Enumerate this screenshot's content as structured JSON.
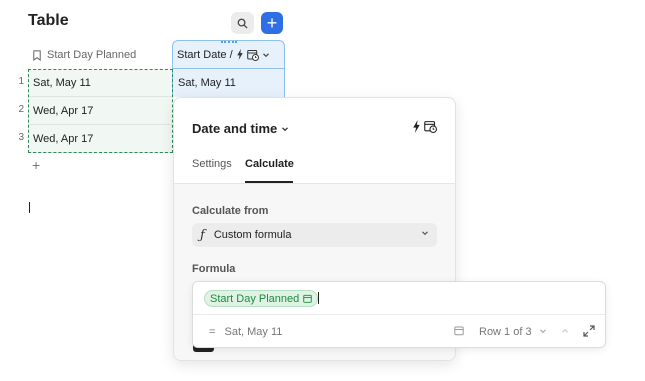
{
  "header": {
    "title": "Table"
  },
  "table": {
    "columns": [
      {
        "label": "Start Day Planned"
      },
      {
        "label": "Start Date / Time"
      }
    ],
    "row_numbers": [
      "1",
      "2",
      "3"
    ],
    "col1_values": [
      "Sat, May 11",
      "Wed, Apr 17",
      "Wed, Apr 17"
    ],
    "col2_values": [
      "Sat, May 11"
    ],
    "add_row": "+"
  },
  "panel": {
    "title": "Date and time",
    "tabs": [
      {
        "label": "Settings"
      },
      {
        "label": "Calculate"
      }
    ],
    "active_tab": "Calculate",
    "calculate_from_label": "Calculate from",
    "calculate_from_value": "Custom formula",
    "formula_label": "Formula"
  },
  "formula": {
    "token": "Start Day Planned",
    "result_prefix": "=",
    "result": "Sat, May 11",
    "row_counter": "Row 1 of 3"
  },
  "icons": {
    "search": "search-icon",
    "add": "plus-icon",
    "bookmark": "bookmark-icon",
    "bolt": "bolt-icon",
    "calendar_clock": "calendar-clock-icon",
    "chevron": "chevron-down-icon",
    "function": "function-icon",
    "calendar": "calendar-icon",
    "expand": "expand-icon"
  },
  "colors": {
    "accent": "#2f6fe6",
    "selection": "#2e8b57",
    "chip_green": "#1f8a3f",
    "column_highlight": "#e6f1fb"
  }
}
